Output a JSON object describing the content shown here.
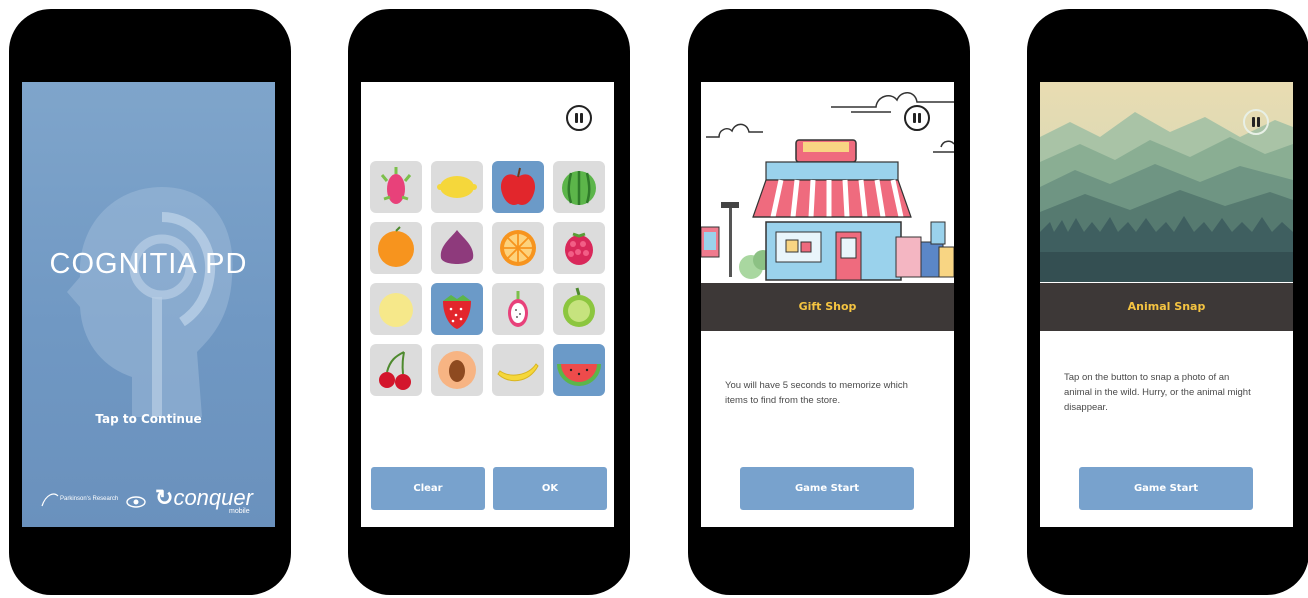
{
  "splash": {
    "title": "COGNITIA PD",
    "tap_label": "Tap to Continue",
    "partner_logo_text": "Parkinson's Research",
    "conquer_logo": "conquer",
    "conquer_logo_sub": "mobile"
  },
  "memory_game": {
    "pause_icon": "pause-icon",
    "tiles": [
      {
        "fruit": "dragonfruit",
        "selected": false
      },
      {
        "fruit": "lemon",
        "selected": false
      },
      {
        "fruit": "apple",
        "selected": true
      },
      {
        "fruit": "watermelon",
        "selected": false
      },
      {
        "fruit": "orange",
        "selected": false
      },
      {
        "fruit": "fig",
        "selected": false
      },
      {
        "fruit": "orange-slice",
        "selected": false
      },
      {
        "fruit": "raspberry",
        "selected": false
      },
      {
        "fruit": "melon",
        "selected": false
      },
      {
        "fruit": "strawberry",
        "selected": true
      },
      {
        "fruit": "dragonfruit-half",
        "selected": false
      },
      {
        "fruit": "lime",
        "selected": false
      },
      {
        "fruit": "cherry",
        "selected": false
      },
      {
        "fruit": "peach",
        "selected": false
      },
      {
        "fruit": "banana",
        "selected": false
      },
      {
        "fruit": "watermelon-slice",
        "selected": true
      }
    ],
    "clear_label": "Clear",
    "ok_label": "OK"
  },
  "gift_shop": {
    "title": "Gift Shop",
    "description": "You will have 5 seconds to memorize which items to find from the store.",
    "start_label": "Game Start"
  },
  "animal_snap": {
    "title": "Animal Snap",
    "description": "Tap on the button to snap a photo of an animal in the wild. Hurry, or the animal might disappear.",
    "start_label": "Game Start"
  },
  "colors": {
    "accent_blue": "#78a2cd",
    "banner_dark": "#3d3837",
    "banner_text": "#f5c441"
  }
}
